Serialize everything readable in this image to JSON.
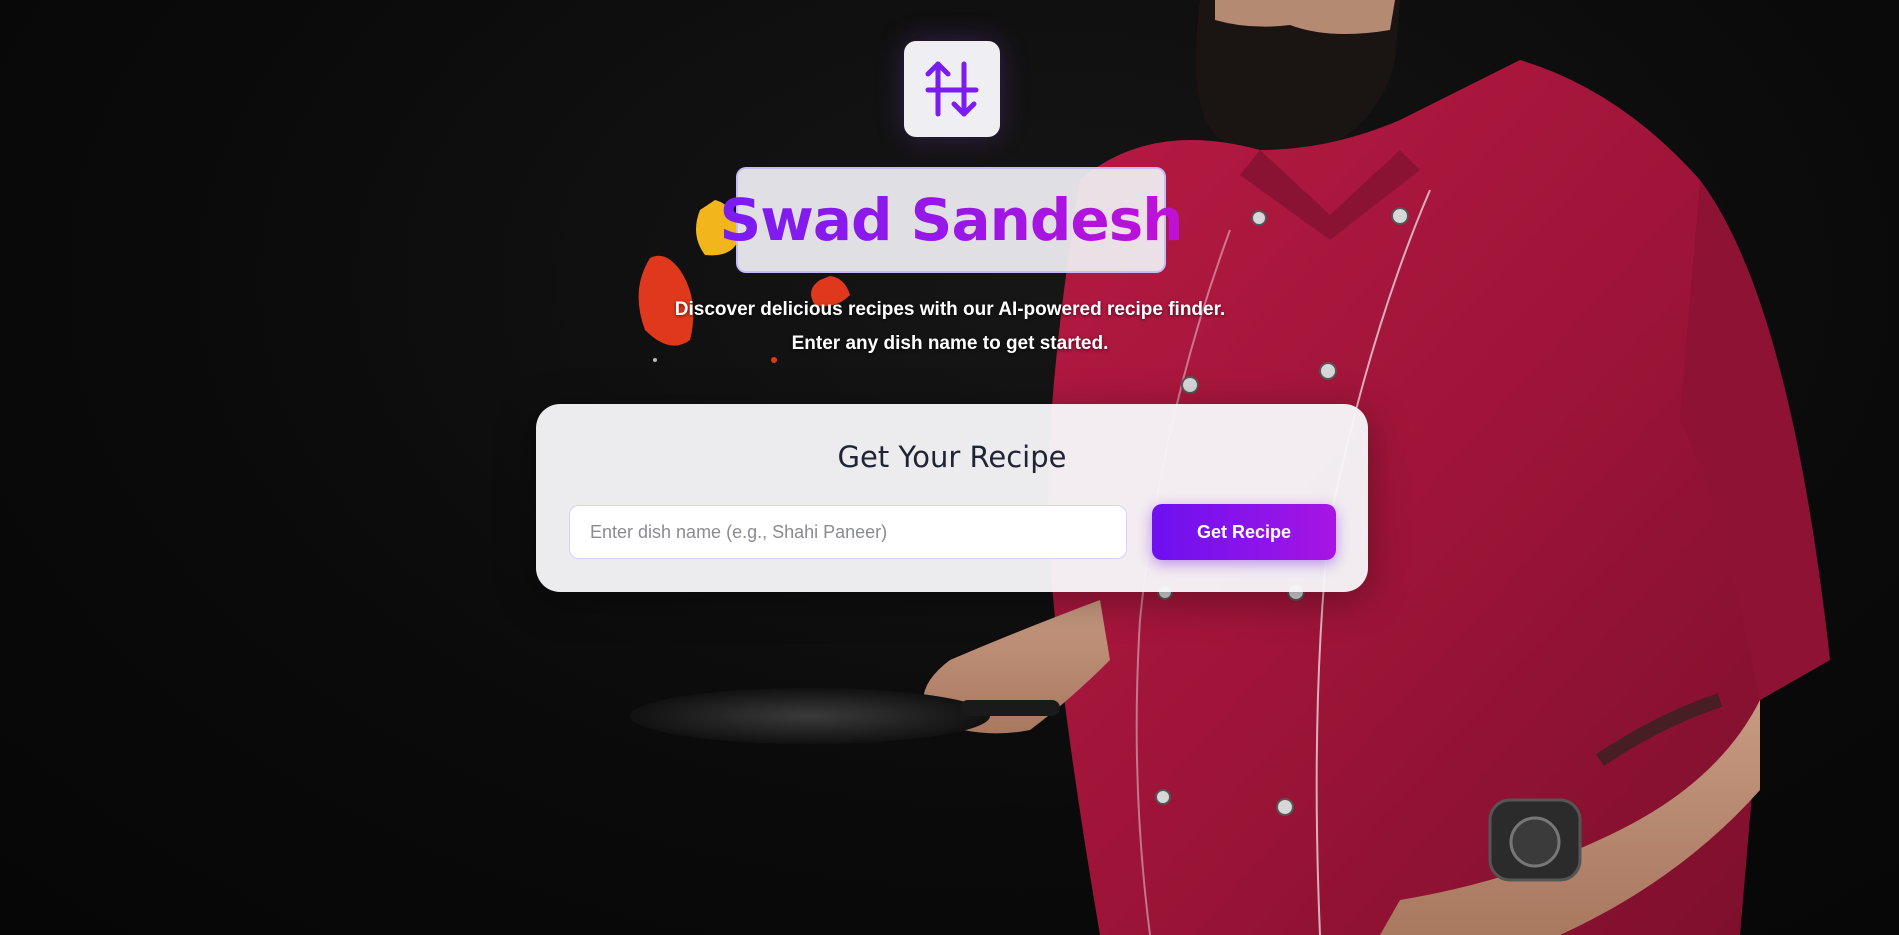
{
  "app": {
    "title": "Swad Sandesh",
    "logo_icon": "up-down-arrows-icon",
    "subtitle_line1": "Discover delicious recipes with our AI-powered recipe finder.",
    "subtitle_line2": "Enter any dish name to get started."
  },
  "recipe_form": {
    "heading": "Get Your Recipe",
    "input_placeholder": "Enter dish name (e.g., Shahi Paneer)",
    "input_value": "",
    "button_label": "Get Recipe"
  },
  "colors": {
    "accent_start": "#6d10f0",
    "accent_end": "#a815e2",
    "background": "#0b0b0b",
    "chef_coat": "#a3163b"
  }
}
